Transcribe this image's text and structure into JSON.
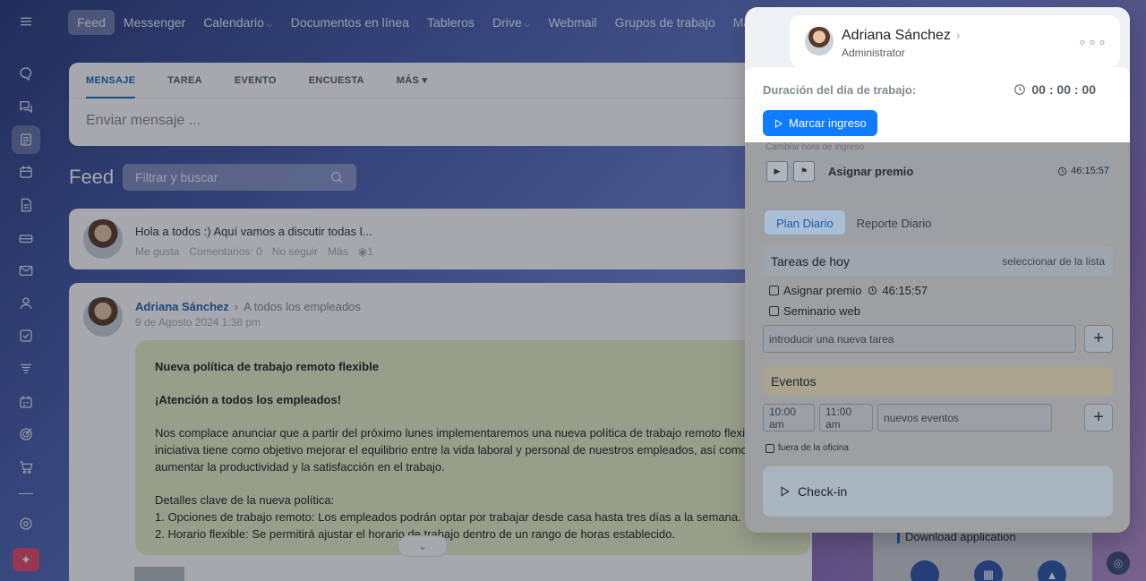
{
  "nav": {
    "items": [
      {
        "label": "Feed",
        "active": true,
        "dropdown": false
      },
      {
        "label": "Messenger",
        "active": false,
        "dropdown": false
      },
      {
        "label": "Calendario",
        "active": false,
        "dropdown": true
      },
      {
        "label": "Documentos en línea",
        "active": false,
        "dropdown": false
      },
      {
        "label": "Tableros",
        "active": false,
        "dropdown": false
      },
      {
        "label": "Drive",
        "active": false,
        "dropdown": true
      },
      {
        "label": "Webmail",
        "active": false,
        "dropdown": false
      },
      {
        "label": "Grupos de trabajo",
        "active": false,
        "dropdown": false
      },
      {
        "label": "Más",
        "active": false,
        "dropdown": true
      }
    ]
  },
  "sidebar": {
    "icons": [
      "menu-icon",
      "chat-bubble-icon",
      "messages-icon",
      "feed-icon",
      "calendar-icon",
      "document-icon",
      "drive-icon",
      "mail-icon",
      "contacts-icon",
      "tasks-icon",
      "filter-icon",
      "schedule-icon",
      "target-icon",
      "cart-icon",
      "settings-icon",
      "app-icon"
    ]
  },
  "composer": {
    "tabs": [
      "MENSAJE",
      "TAREA",
      "EVENTO",
      "ENCUESTA",
      "MÁS"
    ],
    "placeholder": "Enviar mensaje ..."
  },
  "feed": {
    "title": "Feed",
    "search_placeholder": "Filtrar y buscar"
  },
  "post1": {
    "text": "Hola a todos :) Aquí vamos a discutir todas l...",
    "actions": [
      "Me gusta",
      "Comentarios: 0",
      "No seguir",
      "Más"
    ],
    "views": "1"
  },
  "post2": {
    "author": "Adriana Sánchez",
    "destination": "A todos los empleados",
    "date": "9 de Agosto 2024 1:38 pm",
    "heading": "Nueva política de trabajo remoto flexible",
    "attention": "¡Atención a todos los empleados!",
    "para1": "Nos complace anunciar que a partir del próximo lunes implementaremos una nueva política de trabajo remoto flexible. Esta iniciativa tiene como objetivo mejorar el equilibrio entre la vida laboral y personal de nuestros empleados, así como aumentar la productividad y la satisfacción en el trabajo.",
    "details_title": "Detalles clave de la nueva política:",
    "detail1": "1. Opciones de trabajo remoto: Los empleados podrán optar por trabajar desde casa hasta tres días a la semana.",
    "detail2": "2. Horario flexible: Se permitirá ajustar el horario de trabajo dentro de un rango de horas establecido."
  },
  "widget": {
    "user_name": "Adriana Sánchez",
    "user_role": "Administrator",
    "workday_label": "Duración del día de trabajo:",
    "workday_timer": "00 : 00 : 00",
    "checkin_button": "Marcar ingreso",
    "change_time": "Cambiar hora de ingreso",
    "current_task": "Asignar premio",
    "current_task_time": "46:15:57",
    "plan_tabs": [
      "Plan Diario",
      "Reporte Diario"
    ],
    "tasks_title": "Tareas de hoy",
    "tasks_link": "seleccionar de la lista",
    "tasks": [
      {
        "label": "Asignar premio",
        "time": "46:15:57"
      },
      {
        "label": "Seminario web",
        "time": ""
      }
    ],
    "new_task_placeholder": "introducir una nueva tarea",
    "events_title": "Eventos",
    "event_start": "10:00 am",
    "event_end": "11:00 am",
    "new_event_placeholder": "nuevos eventos",
    "out_of_office": "fuera de la oficina",
    "checkin_label": "Check-in"
  },
  "download": {
    "title": "Download application"
  }
}
